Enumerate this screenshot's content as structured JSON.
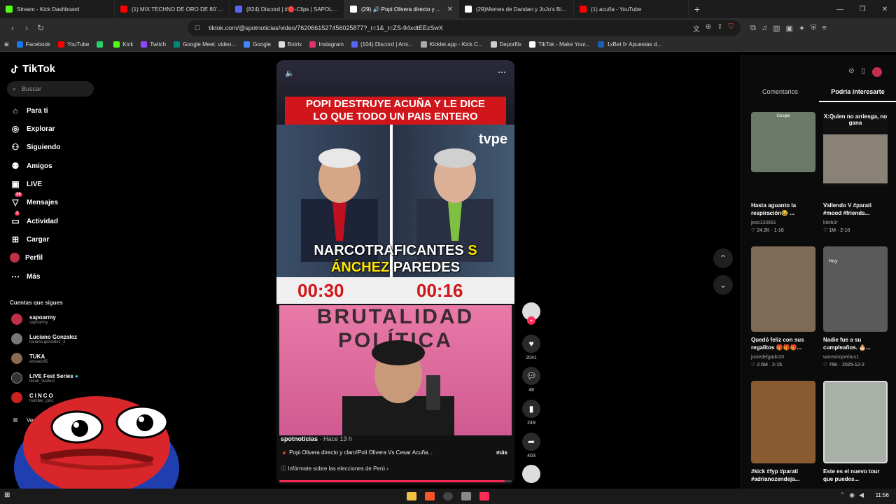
{
  "browser": {
    "tabs": [
      {
        "title": "Stream - Kick Dashboard",
        "color": "#53fc18"
      },
      {
        "title": "(1) MIX TECHNO DE ORO DE 80's & ...",
        "color": "#ff0000"
      },
      {
        "title": "(824) Discord | #🔴-Clips | SAPOLIOS",
        "color": "#5865f2"
      },
      {
        "title": "(29) 🔊 Popi Olivera directo y ...",
        "color": "#111111"
      },
      {
        "title": "(29)Memes de Dandan y JoJo's Bizarr...",
        "color": "#111111"
      },
      {
        "title": "(1) acuña - YouTube",
        "color": "#ff0000"
      }
    ],
    "url": "tiktok.com/@spotnoticias/video/7620661527456025877?_r=1&_t=ZS-94xdtEEzSwX",
    "bookmarks": [
      {
        "label": "Facebook",
        "color": "#1877f2"
      },
      {
        "label": "YouTube",
        "color": "#ff0000"
      },
      {
        "label": "",
        "color": "#25d366"
      },
      {
        "label": "Kick",
        "color": "#53fc18"
      },
      {
        "label": "Twitch",
        "color": "#9146ff"
      },
      {
        "label": "Google Meet: video...",
        "color": "#00897b"
      },
      {
        "label": "Google",
        "color": "#4285f4"
      },
      {
        "label": "Botrix",
        "color": "#dddddd"
      },
      {
        "label": "Instagram",
        "color": "#e1306c"
      },
      {
        "label": "(104) Discord | Ami...",
        "color": "#5865f2"
      },
      {
        "label": "Kicklet.app - Kick C...",
        "color": "#aaaaaa"
      },
      {
        "label": "Deporflix",
        "color": "#cccccc"
      },
      {
        "label": "TikTok - Make Your...",
        "color": "#111111"
      },
      {
        "label": "1xBet ᐅ Apuestas d...",
        "color": "#1a5fb4"
      }
    ]
  },
  "tiktok": {
    "logo": "TikTok",
    "search_placeholder": "Buscar",
    "nav": [
      {
        "label": "Para ti",
        "icon": "home-icon",
        "badge": ""
      },
      {
        "label": "Explorar",
        "icon": "compass-icon",
        "badge": ""
      },
      {
        "label": "Siguiendo",
        "icon": "following-icon",
        "badge": ""
      },
      {
        "label": "Amigos",
        "icon": "friends-icon",
        "badge": ""
      },
      {
        "label": "LIVE",
        "icon": "live-icon",
        "badge": ""
      },
      {
        "label": "Mensajes",
        "icon": "messages-icon",
        "badge": "26"
      },
      {
        "label": "Actividad",
        "icon": "activity-icon",
        "badge": "3"
      },
      {
        "label": "Cargar",
        "icon": "upload-icon",
        "badge": ""
      },
      {
        "label": "Perfil",
        "icon": "profile-icon",
        "badge": ""
      },
      {
        "label": "Más",
        "icon": "more-icon",
        "badge": ""
      }
    ],
    "following_title": "Cuentas que sigues",
    "following": [
      {
        "name": "sapoarmy",
        "user": "sapoarmy",
        "color": "#c0304a"
      },
      {
        "name": "Luciano Gonzalez",
        "user": "luciano.gonzalez_3",
        "color": "#777777"
      },
      {
        "name": "TUKA",
        "user": "asssasdf2",
        "color": "#8a6a50"
      },
      {
        "name": "LIVE Fest Series",
        "user": "tiktok_livefest",
        "color": "#333333"
      },
      {
        "name": "CINCO",
        "user": "number_cinc",
        "color": "#cc2222"
      }
    ],
    "see_more": "Ver"
  },
  "video": {
    "headline_line1": "POPI DESTRUYE ACUÑA Y LE DICE",
    "headline_line2": "LO QUE TODO UN PAIS ENTERO",
    "network": "tvpe",
    "caption_white": "NARCOTRAFICANTES ",
    "caption_yellow1": "S",
    "caption_yellow2": "ÁNCHEZ",
    "caption_white2": " PAREDES",
    "timer_left": "00:30",
    "timer_right": "00:16",
    "stream_banner": "BRUTALIDAD POLÍTICA",
    "author": "spotnoticias",
    "posted": "· Hace 13 h",
    "description": "🔺 Popi Olivera directo y claro!Poli Olivera Vs Cesar Acuña...",
    "more": "más",
    "election_link": "Infórmate sobre las elecciones de Perú",
    "progress": 0.97
  },
  "actions": {
    "likes": "2041",
    "comments": "48",
    "saves": "249",
    "shares": "403"
  },
  "right_panel": {
    "tabs": [
      "Comentarios",
      "Podría interesarte"
    ],
    "cards": [
      {
        "title": "Hasta aguanto la respiración😂 ...",
        "user": "jess133661",
        "likes": "24.2K",
        "date": "1-16",
        "color": "#6b7a68",
        "overlay": "Google"
      },
      {
        "title": "Vallendo V #parati #mood #friends...",
        "user": "kleib3r",
        "likes": "1M",
        "date": "2-10",
        "color": "#8a8276",
        "overlay": "X:Quien no arriesga, no gana"
      },
      {
        "title": "Quedó feliz con sus regalitos 🎁🎁🎁...",
        "user": "josiedelgado20",
        "likes": "2.5M",
        "date": "2-15",
        "color": "#7e6a55",
        "overlay": ""
      },
      {
        "title": "Nadie fue a su cumpleaños. 🎂...",
        "user": "wareximperitus1",
        "likes": "76K",
        "date": "2025-12-2",
        "color": "#5a5a5a",
        "overlay": "Hoy"
      },
      {
        "title": "#kick #fyp #parati #adrianozendeja...",
        "user": "",
        "likes": "",
        "date": "",
        "color": "#8a5a30",
        "overlay": ""
      },
      {
        "title": "Este es el nuevo tour que puedes...",
        "user": "",
        "likes": "",
        "date": "",
        "color": "#a8b0a8",
        "overlay": ""
      }
    ]
  },
  "taskbar": {
    "time": "11:56"
  }
}
